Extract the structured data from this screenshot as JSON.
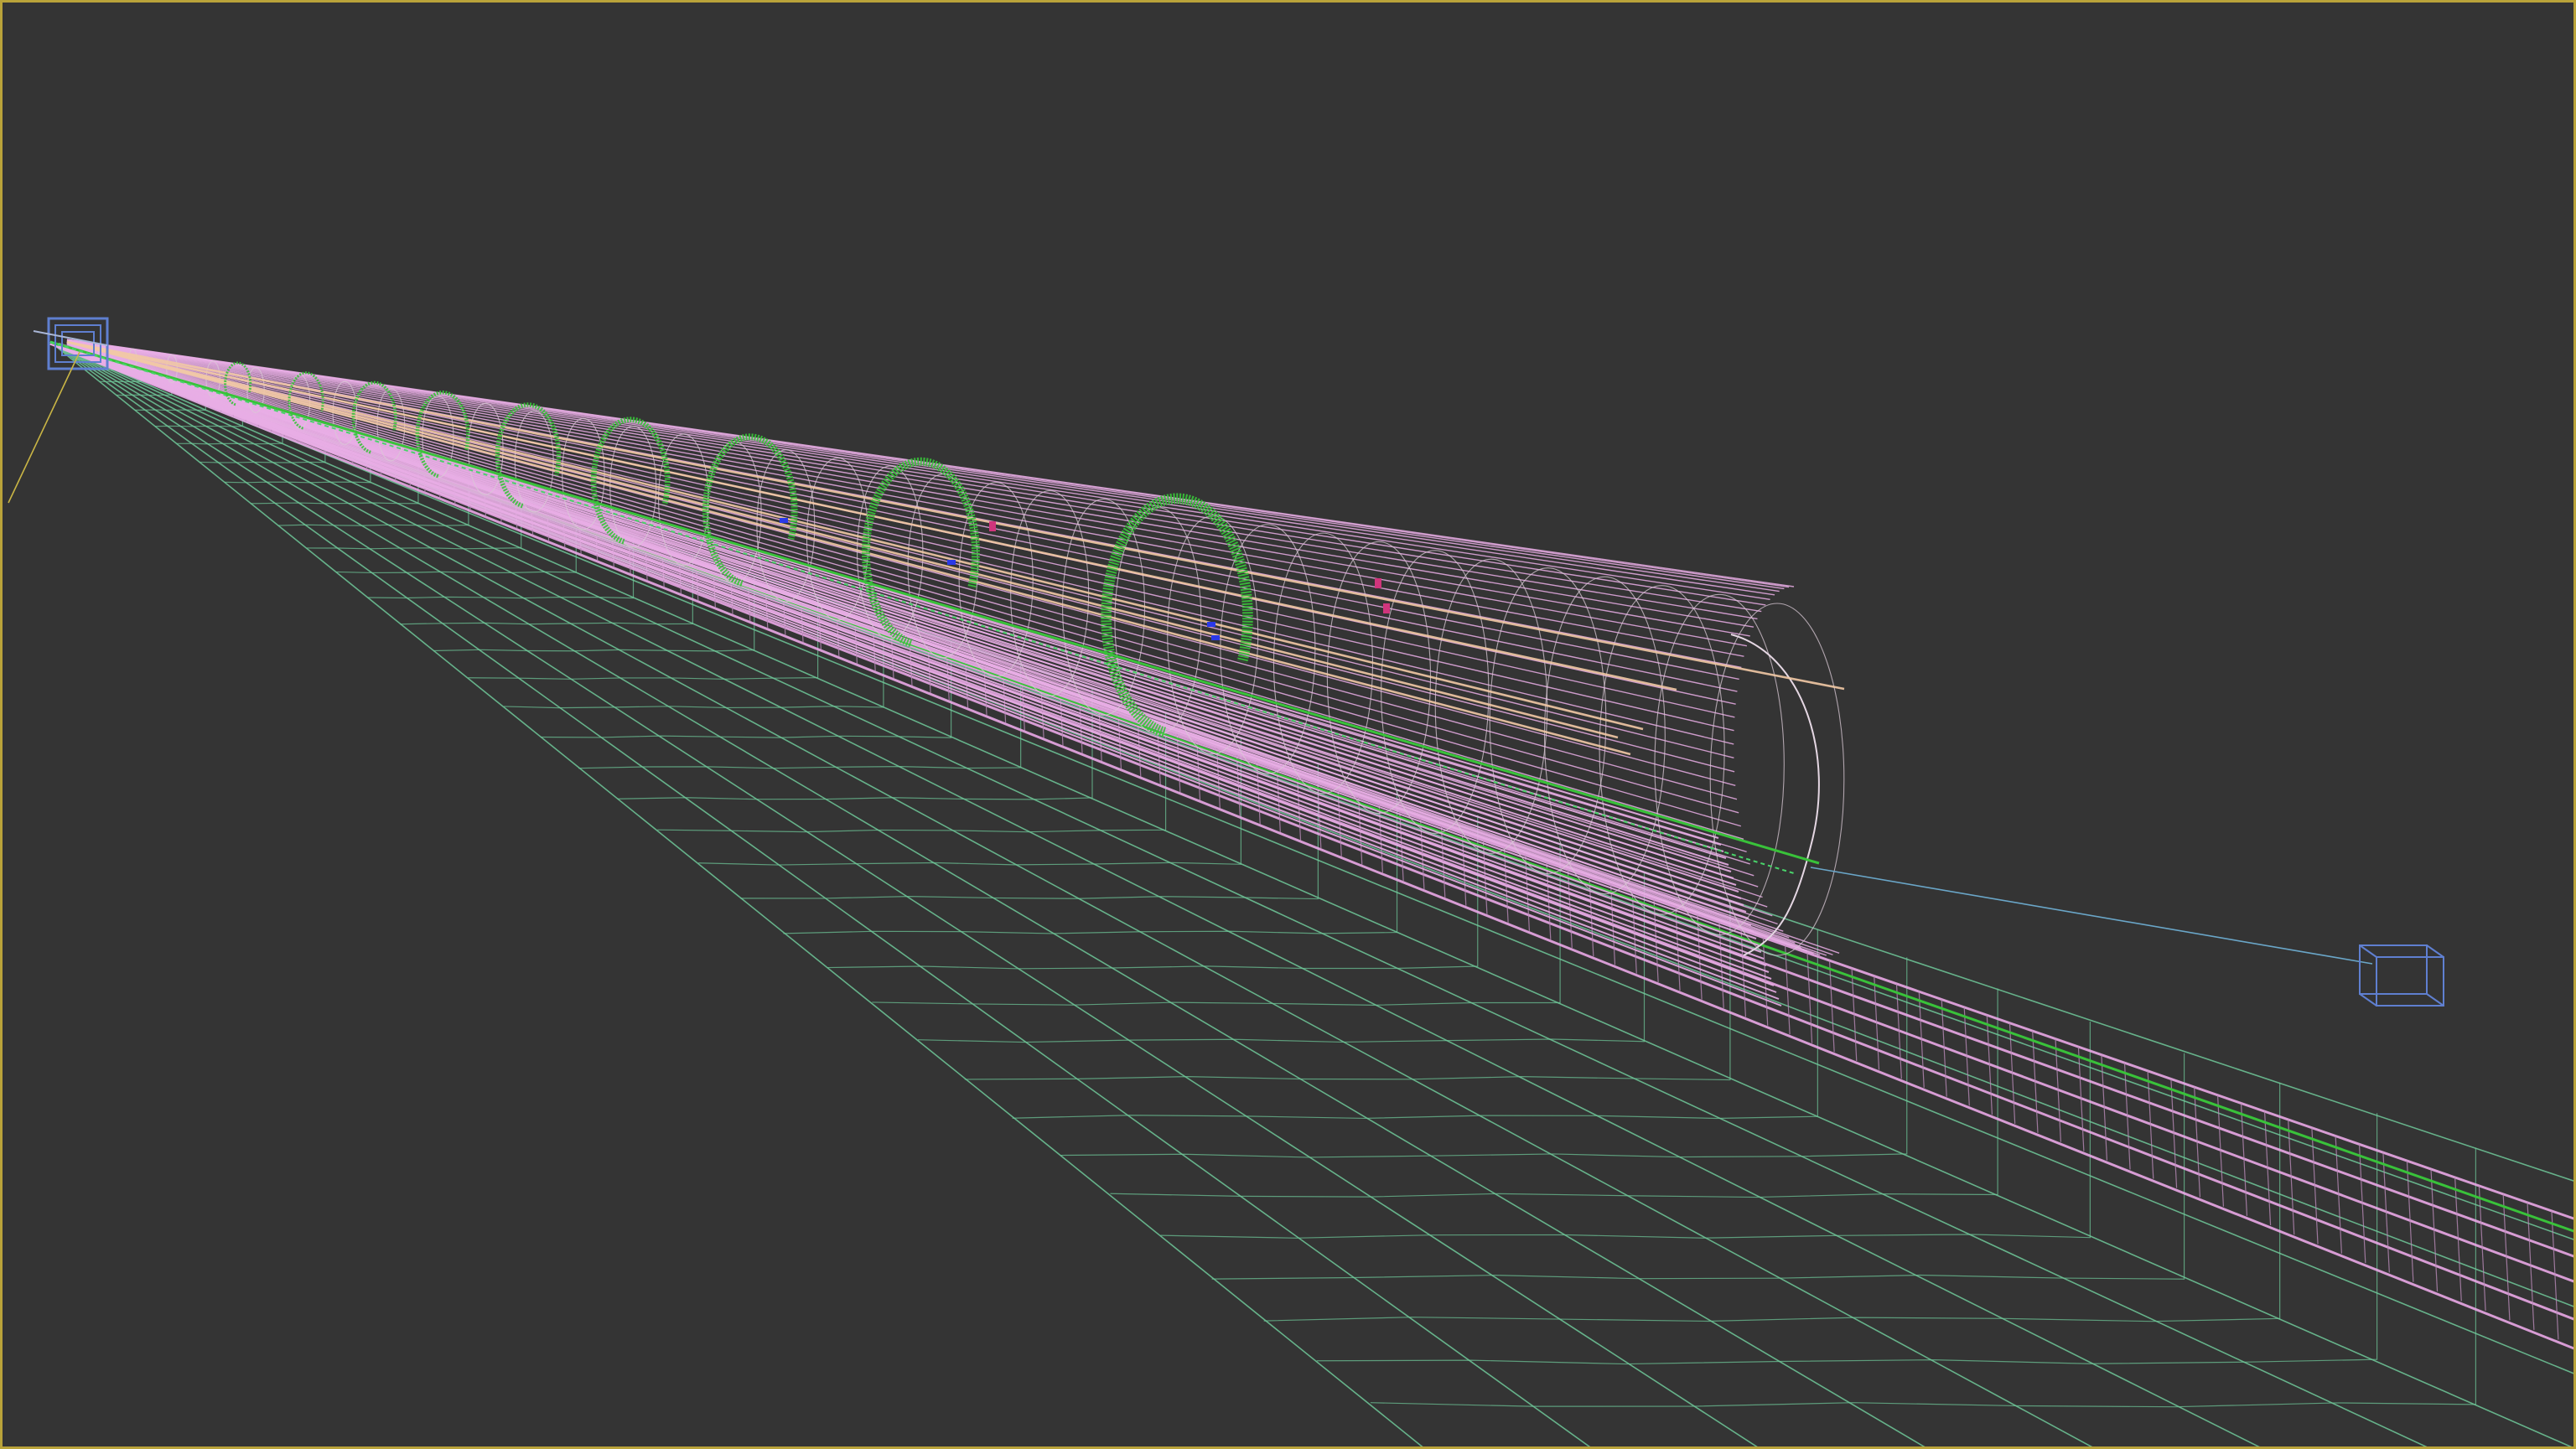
{
  "viewport": {
    "mode": "wireframe",
    "active": true,
    "colors": {
      "background": "#343434",
      "active_border": "#b9a33a",
      "tunnel_wire": "#e9aee6",
      "ring_wire": "#39c23a",
      "ground_wire": "#6fc99a",
      "rail_wire": "#e9a8e6",
      "cable": "#f2c9a6",
      "helper_box": "#5f7fd0",
      "camera_line": "#6aa6c8",
      "target_line": "#c9b545",
      "accent_blue": "#2a39e8",
      "accent_magenta": "#d0357c"
    },
    "objects": [
      {
        "name": "tunnel-shell",
        "icon": "wireframe-cylinder"
      },
      {
        "name": "support-rings",
        "icon": "wireframe-ring"
      },
      {
        "name": "ground-mesh",
        "icon": "wireframe-plane"
      },
      {
        "name": "rail-track",
        "icon": "wireframe-track"
      },
      {
        "name": "near-helper",
        "icon": "cube-icon"
      },
      {
        "name": "far-helper",
        "icon": "cube-icon"
      }
    ]
  }
}
